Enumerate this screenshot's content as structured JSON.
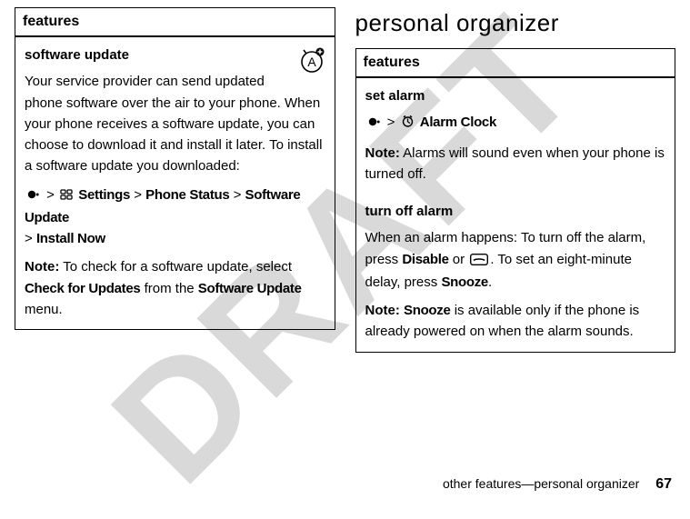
{
  "watermark": "DRAFT",
  "left": {
    "header": "features",
    "row1_title": "software update",
    "row1_p1": "Your service provider can send updated phone software over the air to your phone. When your phone receives a software update, you can choose to download it and install it later. To install a software update you downloaded:",
    "path_settings": "Settings",
    "path_phone_status": "Phone Status",
    "path_software_update": "Software Update",
    "path_install_now": "Install Now",
    "note_label": "Note:",
    "row1_note_text": " To check for a software update, select ",
    "check_for_updates": "Check for Updates",
    "row1_note_tail": " from the ",
    "software_update2": "Software Update",
    "row1_note_end": " menu."
  },
  "right": {
    "heading": "personal organizer",
    "header": "features",
    "row1_title": "set alarm",
    "alarm_clock": "Alarm Clock",
    "note_label": "Note:",
    "row1_note": " Alarms will sound even when your phone is turned off.",
    "row2_title": "turn off alarm",
    "row2_p1a": "When an alarm happens: To turn off the alarm, press ",
    "disable": "Disable",
    "row2_p1b": " or ",
    "row2_p1c": ". To set an eight-minute delay, press ",
    "snooze": "Snooze",
    "row2_p1d": ".",
    "row2_note_a": " ",
    "snooze2": "Snooze",
    "row2_note_b": " is available only if the phone is already powered on when the alarm sounds."
  },
  "footer": {
    "text": "other features—personal organizer",
    "page": "67"
  }
}
